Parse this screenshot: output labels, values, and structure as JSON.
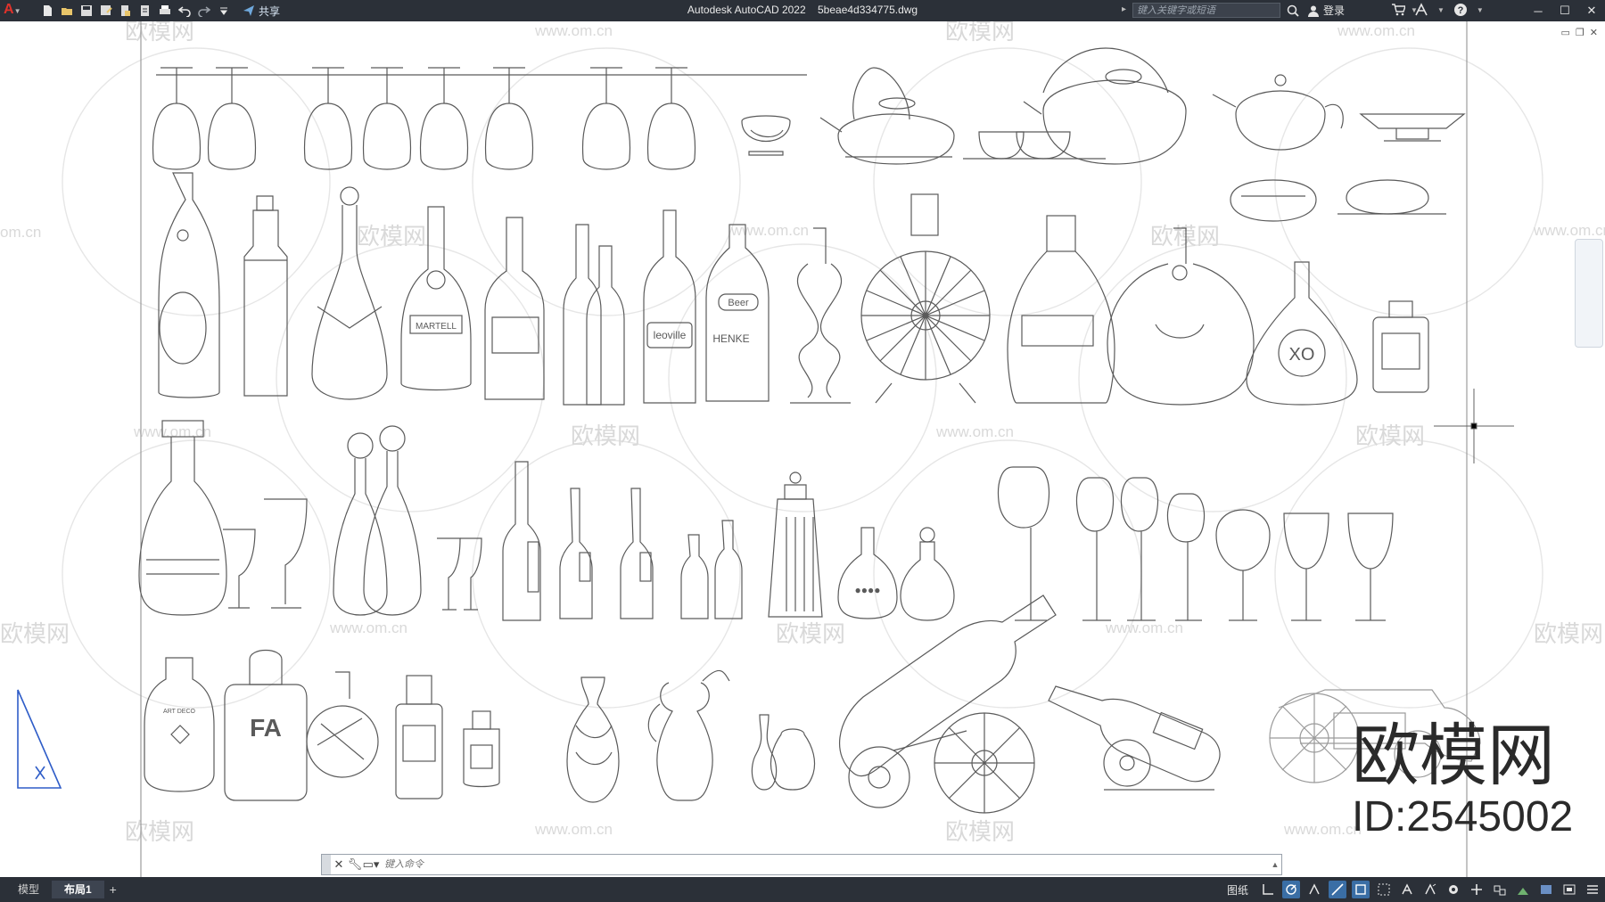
{
  "app": {
    "logo_letter": "A",
    "title": "Autodesk AutoCAD 2022",
    "filename": "5beae4d334775.dwg"
  },
  "quick_access": {
    "share_label": "共享",
    "icons": [
      "new-file-icon",
      "open-file-icon",
      "save-icon",
      "save-as-icon",
      "publish-icon",
      "plot-preview-icon",
      "print-icon",
      "undo-icon",
      "redo-icon",
      "customize-icon"
    ]
  },
  "search": {
    "placeholder": "键入关键字或短语"
  },
  "account": {
    "login_label": "登录"
  },
  "watermark": {
    "logo_text": "欧模网",
    "url_text": "www.om.cn",
    "url_text_short": "om.cn",
    "id_text": "ID:2545002"
  },
  "command_line": {
    "placeholder": "键入命令"
  },
  "layout_tabs": [
    {
      "label": "模型",
      "active": false
    },
    {
      "label": "布局1",
      "active": true
    }
  ],
  "status_bar": {
    "paper_label": "图纸"
  },
  "drawing_labels": {
    "beer": "Beer",
    "henke": "HENKE",
    "leoville": "leoville",
    "martell": "MARTELL",
    "xo": "XO",
    "fa": "FA",
    "chateau": "ART DECO"
  },
  "colors": {
    "titlebar_bg": "#2b3038",
    "line_color": "#5a5a5a",
    "watermark_color": "#d9d9d9",
    "crosshair": "#606060",
    "ucs_blue": "#2f5dc8"
  }
}
